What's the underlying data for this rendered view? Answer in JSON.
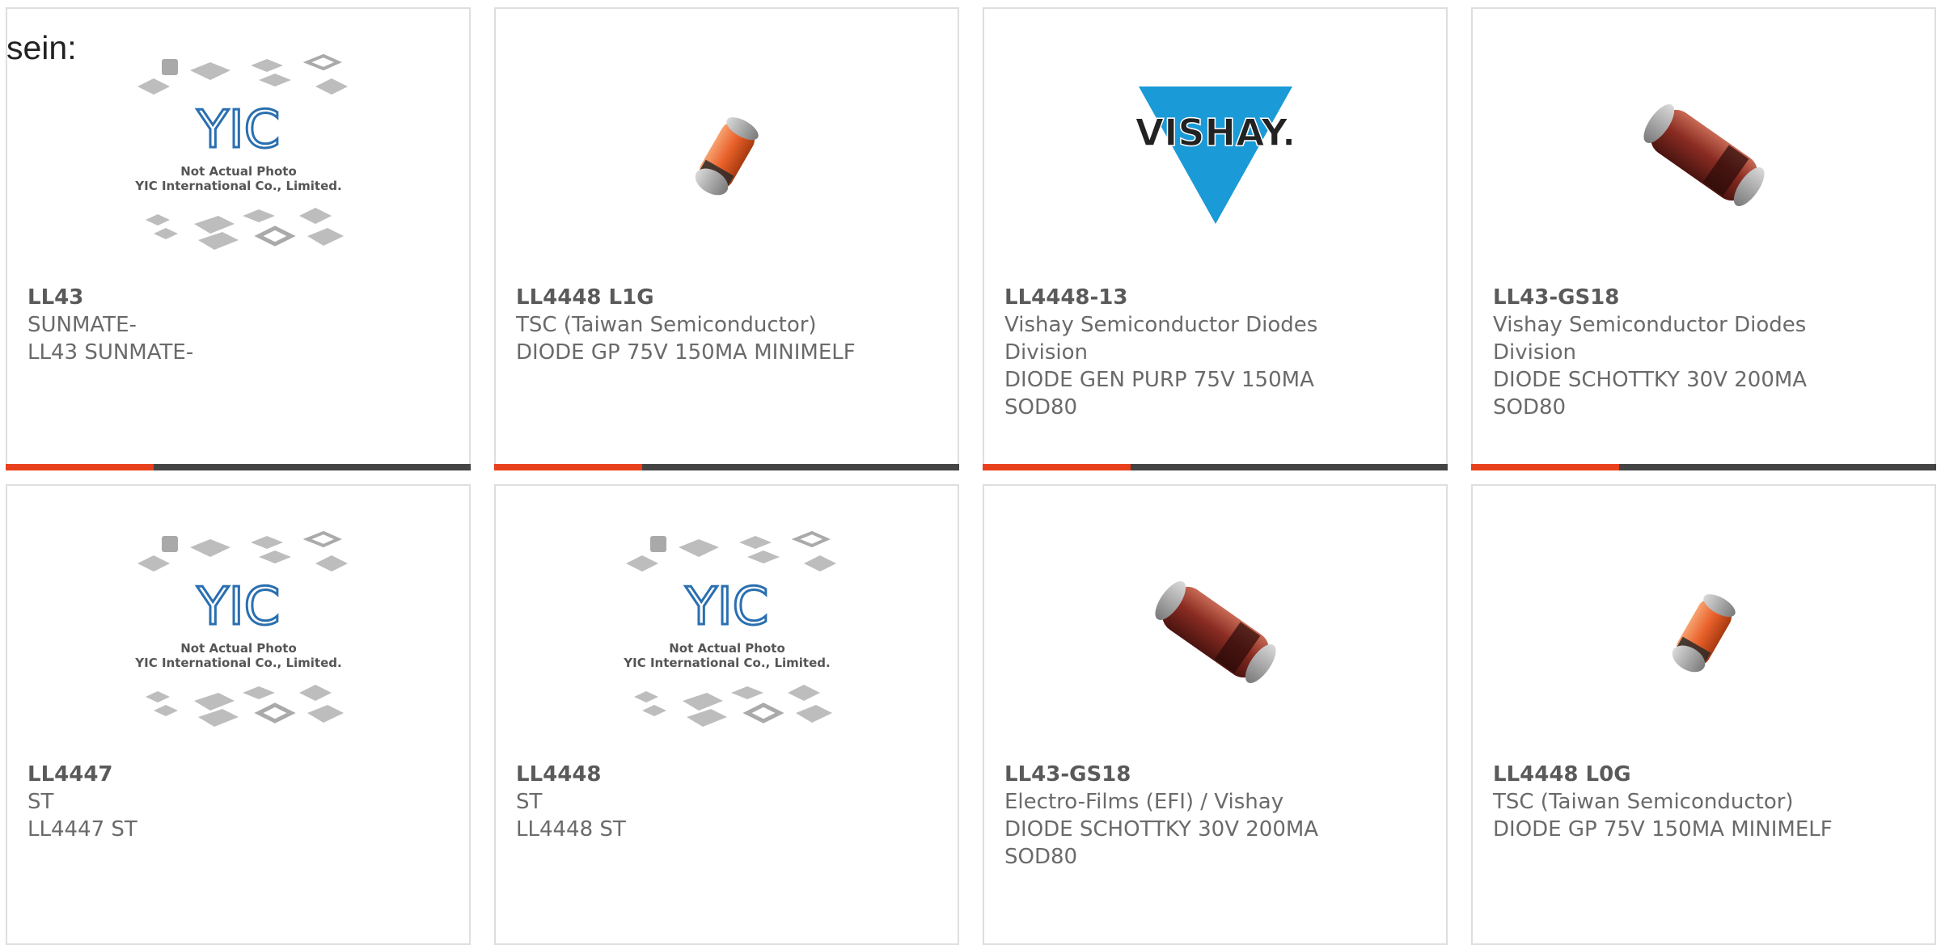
{
  "intro_text": "sein:",
  "placeholder": {
    "line1": "Not Actual Photo",
    "line2": "YIC International Co., Limited.",
    "logo": "YIC"
  },
  "vishay_logo_text": "VISHAY.",
  "colors": {
    "accent": "#e8401c",
    "bar": "#444444",
    "border": "#dedede",
    "vishay_blue": "#1a9ad6",
    "yic_blue": "#2a6fb0"
  },
  "cards": [
    {
      "part": "LL43",
      "lines": [
        "SUNMATE-",
        "LL43 SUNMATE-"
      ],
      "image": "yic-placeholder"
    },
    {
      "part": "LL4448 L1G",
      "lines": [
        "TSC (Taiwan Semiconductor)",
        "DIODE GP 75V 150MA MINIMELF"
      ],
      "image": "orange-diode"
    },
    {
      "part": "LL4448-13",
      "lines": [
        "Vishay Semiconductor Diodes",
        "Division",
        "DIODE GEN PURP 75V 150MA",
        "SOD80"
      ],
      "image": "vishay-logo"
    },
    {
      "part": "LL43-GS18",
      "lines": [
        "Vishay Semiconductor Diodes",
        "Division",
        "DIODE SCHOTTKY 30V 200MA",
        "SOD80"
      ],
      "image": "red-diode"
    },
    {
      "part": "LL4447",
      "lines": [
        "ST",
        "LL4447 ST"
      ],
      "image": "yic-placeholder"
    },
    {
      "part": "LL4448",
      "lines": [
        "ST",
        "LL4448 ST"
      ],
      "image": "yic-placeholder"
    },
    {
      "part": "LL43-GS18",
      "lines": [
        "Electro-Films (EFI) / Vishay",
        "DIODE SCHOTTKY 30V 200MA",
        "SOD80"
      ],
      "image": "red-diode"
    },
    {
      "part": "LL4448 L0G",
      "lines": [
        "TSC (Taiwan Semiconductor)",
        "DIODE GP 75V 150MA MINIMELF"
      ],
      "image": "orange-diode"
    }
  ]
}
